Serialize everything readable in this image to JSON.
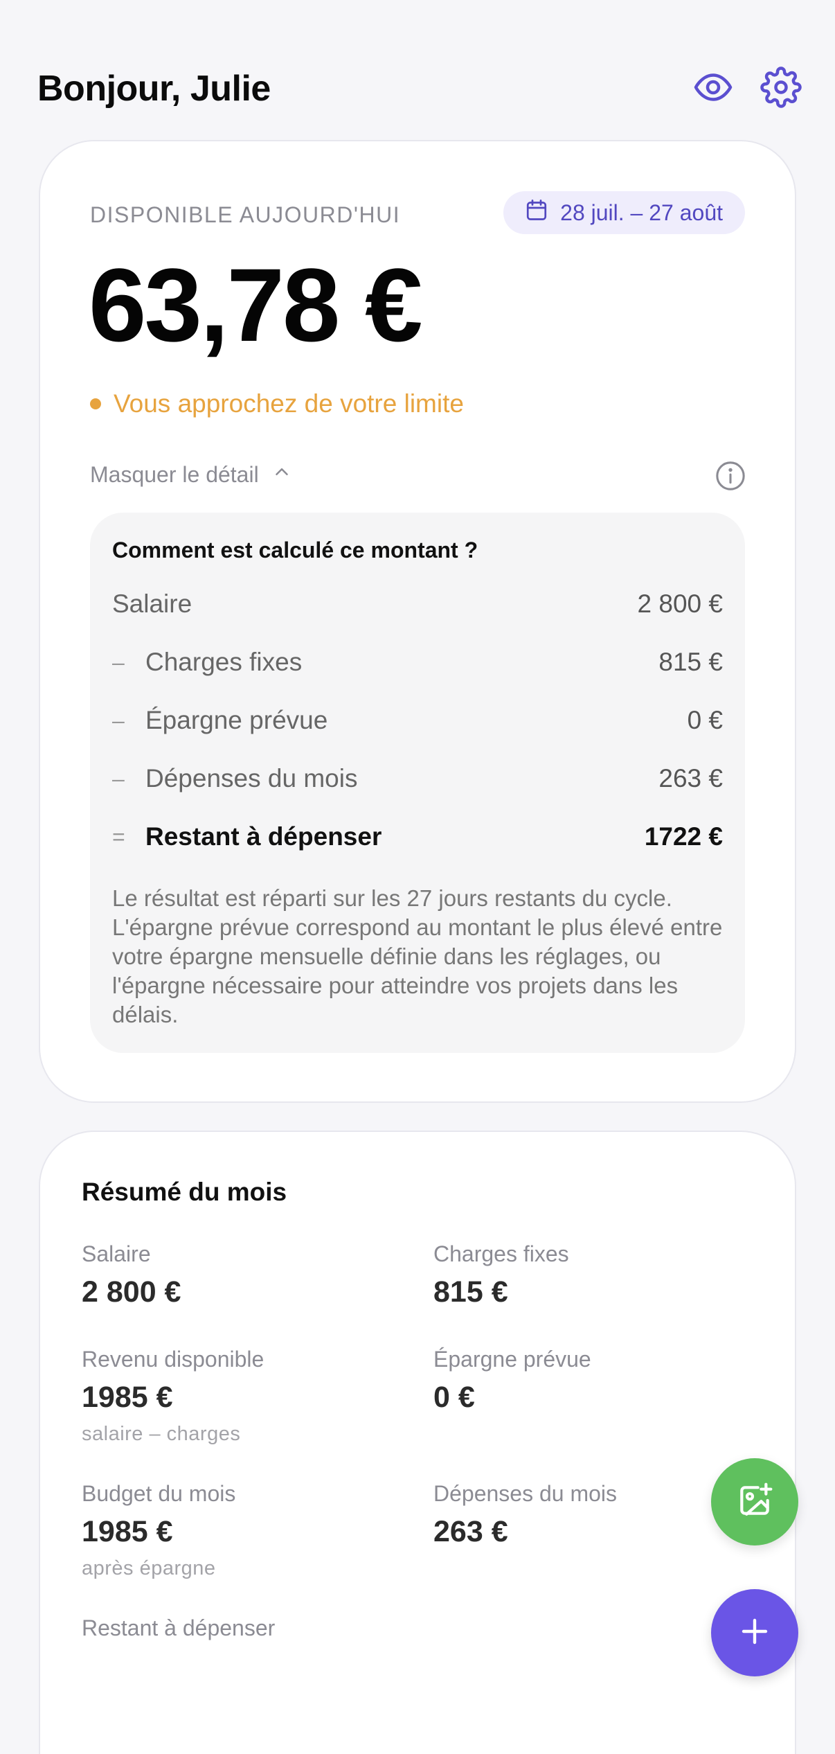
{
  "header": {
    "greeting": "Bonjour, Julie",
    "icons": [
      "eye-icon",
      "gear-icon"
    ]
  },
  "main_card": {
    "available_label": "DISPONIBLE AUJOURD'HUI",
    "period": "28 juil. – 27 août",
    "amount": "63,78 €",
    "warning": "Vous approchez de votre limite",
    "toggle_label": "Masquer le détail",
    "detail": {
      "title": "Comment est calculé ce montant ?",
      "rows": [
        {
          "sign": "",
          "label": "Salaire",
          "value": "2 800 €"
        },
        {
          "sign": "–",
          "label": "Charges fixes",
          "value": "815 €"
        },
        {
          "sign": "–",
          "label": "Épargne prévue",
          "value": "0 €"
        },
        {
          "sign": "–",
          "label": "Dépenses du mois",
          "value": "263 €"
        },
        {
          "sign": "=",
          "label": "Restant à dépenser",
          "value": "1722 €"
        }
      ],
      "note": "Le résultat est réparti sur les 27 jours restants du cycle. L'épargne prévue correspond au montant le plus élevé entre votre épargne mensuelle définie dans les réglages, ou l'épargne nécessaire pour atteindre vos projets dans les délais."
    }
  },
  "summary": {
    "title": "Résumé du mois",
    "cells": [
      {
        "label": "Salaire",
        "value": "2 800 €",
        "sub": ""
      },
      {
        "label": "Charges fixes",
        "value": "815 €",
        "sub": ""
      },
      {
        "label": "Revenu disponible",
        "value": "1985 €",
        "sub": "salaire – charges"
      },
      {
        "label": "Épargne prévue",
        "value": "0 €",
        "sub": ""
      },
      {
        "label": "Budget du mois",
        "value": "1985 €",
        "sub": "après épargne"
      },
      {
        "label": "Dépenses du mois",
        "value": "263 €",
        "sub": ""
      },
      {
        "label": "Restant à dépenser",
        "value": "",
        "sub": ""
      }
    ]
  },
  "colors": {
    "accent": "#6a55e6",
    "warning": "#e7a33e",
    "success": "#5fc05e"
  }
}
